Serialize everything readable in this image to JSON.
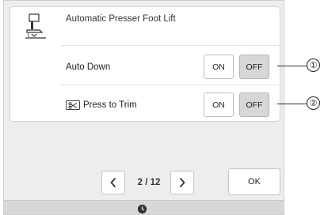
{
  "header": {
    "icon": "presser-foot-icon",
    "title": "Automatic Presser Foot Lift"
  },
  "rows": [
    {
      "label": "Auto Down",
      "on_label": "ON",
      "off_label": "OFF",
      "selected": "OFF",
      "callout": "①"
    },
    {
      "label": "Press to Trim",
      "icon": "trim-icon",
      "on_label": "ON",
      "off_label": "OFF",
      "selected": "OFF",
      "callout": "②"
    }
  ],
  "pager": {
    "prev_icon": "chevron-left-icon",
    "next_icon": "chevron-right-icon",
    "indicator": "2 / 12"
  },
  "ok_label": "OK",
  "status_bar": {
    "icon": "clock-icon"
  },
  "colors": {
    "selected_bg": "#d7d7d7",
    "screen_bg": "#ededed"
  }
}
